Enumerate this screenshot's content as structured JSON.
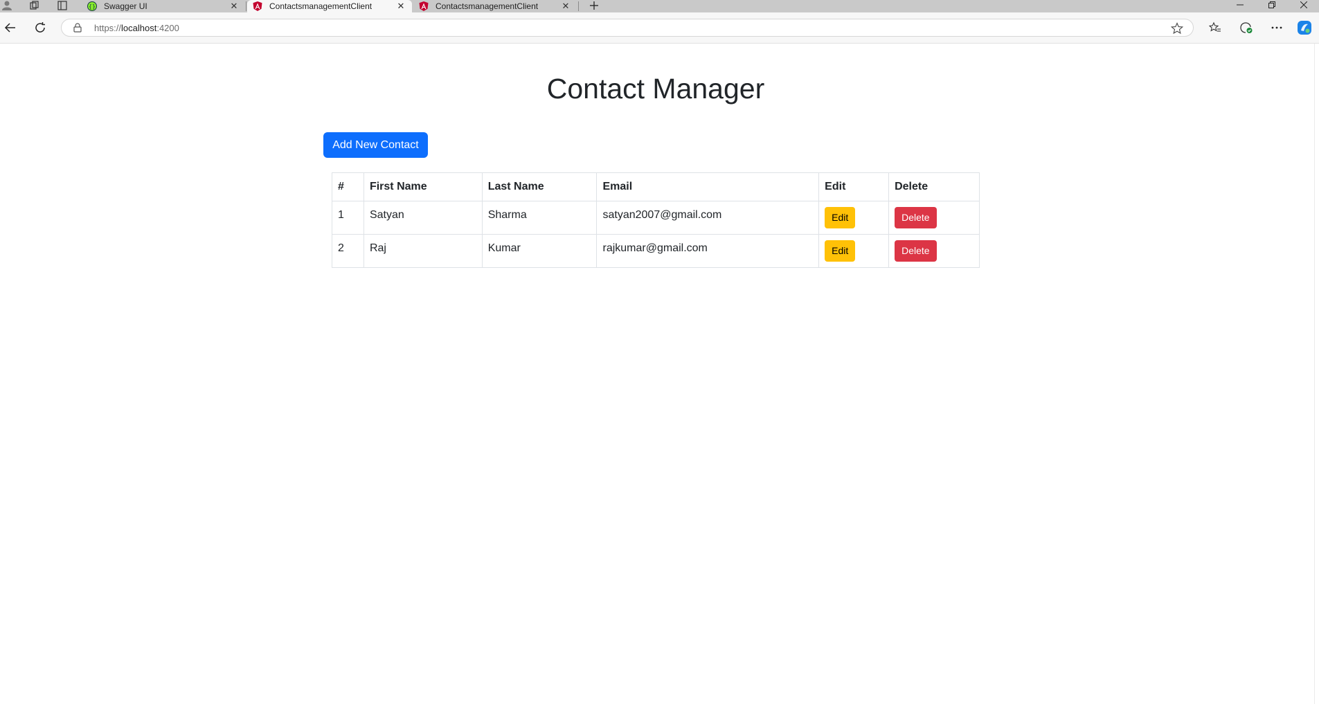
{
  "browser": {
    "tabs": [
      {
        "title": "Swagger UI",
        "favicon": "swagger-icon",
        "active": false
      },
      {
        "title": "ContactsmanagementClient",
        "favicon": "angular-icon",
        "active": true
      },
      {
        "title": "ContactsmanagementClient",
        "favicon": "angular-icon",
        "active": false
      }
    ],
    "url_scheme": "https://",
    "url_host": "localhost",
    "url_port": ":4200"
  },
  "page": {
    "title": "Contact Manager",
    "add_button": "Add New Contact"
  },
  "table": {
    "headers": [
      "#",
      "First Name",
      "Last Name",
      "Email",
      "Edit",
      "Delete"
    ],
    "rows": [
      {
        "id": "1",
        "first": "Satyan",
        "last": "Sharma",
        "email": "satyan2007@gmail.com",
        "edit": "Edit",
        "delete": "Delete"
      },
      {
        "id": "2",
        "first": "Raj",
        "last": "Kumar",
        "email": "rajkumar@gmail.com",
        "edit": "Edit",
        "delete": "Delete"
      }
    ]
  },
  "colors": {
    "primary": "#0d6efd",
    "warning": "#ffc107",
    "danger": "#dc3545"
  }
}
